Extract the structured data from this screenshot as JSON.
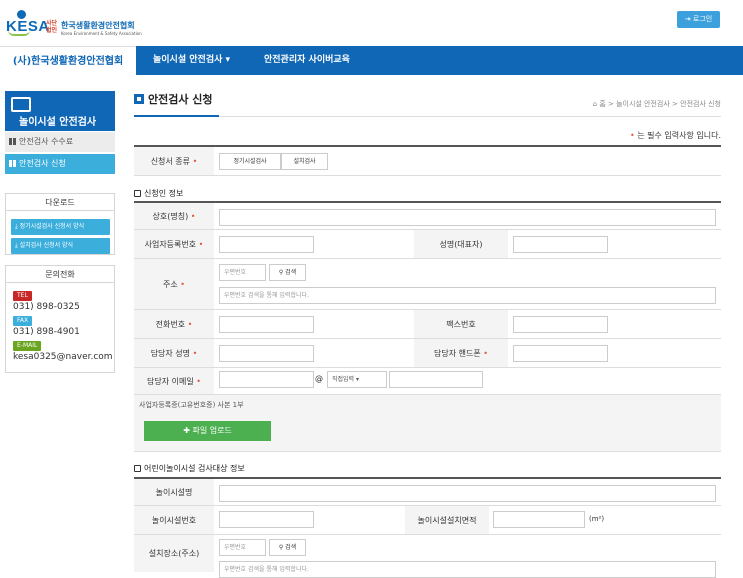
{
  "header": {
    "logo_text": "KESA",
    "logo_small": "사단\n법인",
    "org_name": "한국생활환경안전협회",
    "org_name_en": "Korea Environment & Safety Association",
    "login_label": "로그인"
  },
  "nav": {
    "home": "(사)한국생활환경안전협회",
    "items": [
      "놀이시설 안전검사 ▾",
      "안전관리자 사이버교육"
    ]
  },
  "sidebar": {
    "title": "놀이시설 안전검사",
    "menu": [
      {
        "label": "안전검사 수수료"
      },
      {
        "label": "안전검사 신청"
      }
    ],
    "download_title": "다운로드",
    "downloads": [
      "정기시설검사 신청서 양식",
      "설치검사 신청서 양식"
    ],
    "call_title": "문의전화",
    "tel_label": "TEL",
    "tel": "031) 898-0325",
    "fax_label": "FAX",
    "fax": "031) 898-4901",
    "email_label": "E-MAIL",
    "email": "kesa0325@naver.com"
  },
  "page": {
    "title": "안전검사 신청",
    "breadcrumb": "홈 > 놀이시설 안전검사 > 안전검사 신청",
    "required_note": "는 필수 입력사항 입니다."
  },
  "form": {
    "type_label": "신청서 종류",
    "type_options": [
      "정기시설검사",
      "설치검사"
    ],
    "applicant_section": "신청인 정보",
    "company_label": "상호(명칭)",
    "bizno_label": "사업자등록번호",
    "ceo_label": "성명(대표자)",
    "address_label": "주소",
    "zip_placeholder": "우편번호",
    "search_label": "검색",
    "address_placeholder": "우편번호 검색을 통해 입력합니다.",
    "phone_label": "전화번호",
    "fax_label": "팩스번호",
    "manager_label": "담당자 성명",
    "mobile_label": "담당자 핸드폰",
    "email_label": "담당자 이메일",
    "email_at": "@",
    "email_domain": "직접입력",
    "attachment_note": "사업자등록증(고유번호증) 사본 1부",
    "upload_label": "파일 업로드",
    "facility_section": "어린이놀이시설 검사대상 정보",
    "facility_name_label": "놀이시설명",
    "facility_no_label": "놀이시설번호",
    "facility_area_label": "놀이시설설치면적",
    "area_unit": "(m²)",
    "location_label": "설치장소(주소)"
  },
  "colors": {
    "brand": "#1067b6",
    "accent": "#3caedc",
    "required": "#e0573a",
    "upload": "#4caf50"
  }
}
